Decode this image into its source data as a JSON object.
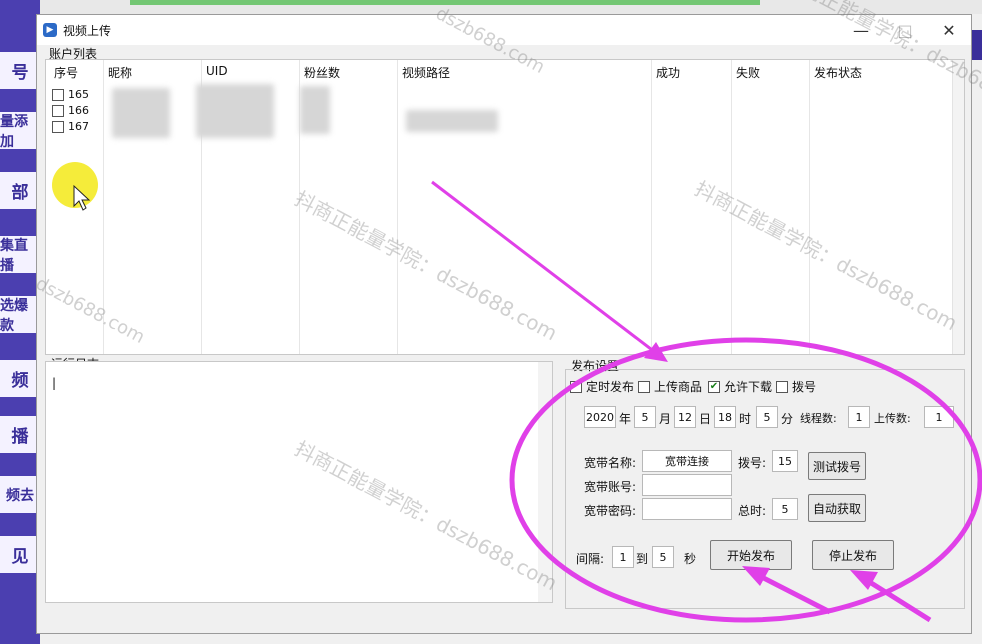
{
  "window": {
    "title": "视频上传",
    "minimize": "—",
    "maximize": "□",
    "close": "✕"
  },
  "account_list": {
    "group_label": "账户列表",
    "columns": [
      "序号",
      "昵称",
      "UID",
      "粉丝数",
      "视频路径",
      "成功",
      "失败",
      "发布状态"
    ],
    "rows": [
      "165",
      "166",
      "167"
    ]
  },
  "log": {
    "group_label": "运行日志",
    "text": "|"
  },
  "publish": {
    "group_label": "发布设置",
    "checkboxes": [
      {
        "label": "定时发布",
        "checked": false
      },
      {
        "label": "上传商品",
        "checked": false
      },
      {
        "label": "允许下载",
        "checked": true
      },
      {
        "label": "拨号",
        "checked": false
      }
    ],
    "year": "2020",
    "year_unit": "年",
    "month": "5",
    "month_unit": "月",
    "day": "12",
    "day_unit": "日",
    "hour": "18",
    "hour_unit": "时",
    "minute": "5",
    "minute_unit": "分",
    "threads_label": "线程数:",
    "threads": "1",
    "upload_count_label": "上传数:",
    "upload_count": "1",
    "broadband_name_label": "宽带名称:",
    "broadband_name": "宽带连接",
    "dial_label": "拨号:",
    "dial": "15",
    "test_dial_button": "测试拨号",
    "broadband_account_label": "宽带账号:",
    "broadband_account": "",
    "broadband_password_label": "宽带密码:",
    "broadband_password": "",
    "total_label": "总时:",
    "total": "5",
    "auto_fetch_button": "自动获取",
    "interval_label": "间隔:",
    "interval_from": "1",
    "to_label": "到",
    "interval_to": "5",
    "seconds_label": "秒",
    "start_button": "开始发布",
    "stop_button": "停止发布"
  },
  "sidebar_bg": {
    "chips": [
      "号",
      "量添加",
      "部",
      "集直播",
      "选爆款",
      "频",
      "播",
      "频去",
      "见"
    ]
  },
  "watermarks": [
    "抖商正能量学院：dszb688.com",
    "抖商正能量学院：dszb688.com",
    "抖商正能量学院：dszb688.com",
    "抖商正能量学院：dszb688.com",
    "dszb688.com",
    "dszb688.com"
  ],
  "colors": {
    "annotation": "#e040e8",
    "mouse_highlight": "#f5ec3a",
    "accent": "#4b3fb0"
  }
}
